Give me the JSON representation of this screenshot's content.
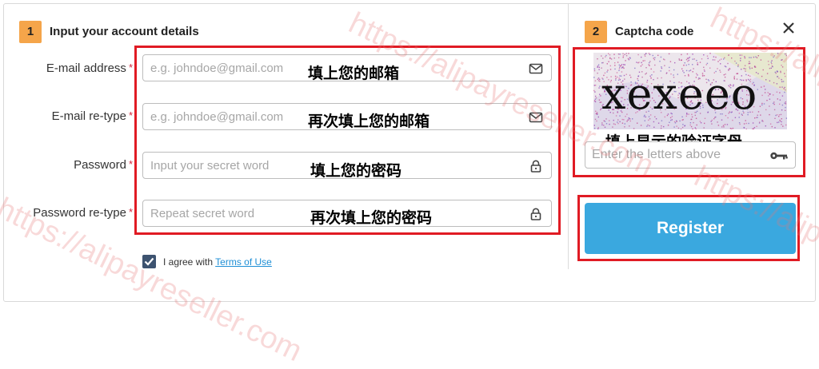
{
  "step1": {
    "number": "1",
    "title": "Input your account details"
  },
  "step2": {
    "number": "2",
    "title": "Captcha code"
  },
  "fields": [
    {
      "label": "E-mail address",
      "required": "*",
      "placeholder": "e.g. johndoe@gmail.com",
      "icon": "envelope-icon",
      "annotation": "填上您的邮箱"
    },
    {
      "label": "E-mail re-type",
      "required": "*",
      "placeholder": "e.g. johndoe@gmail.com",
      "icon": "envelope-icon",
      "annotation": "再次填上您的邮箱"
    },
    {
      "label": "Password",
      "required": "*",
      "placeholder": "Input your secret word",
      "icon": "lock-icon",
      "annotation": "填上您的密码"
    },
    {
      "label": "Password re-type",
      "required": "*",
      "placeholder": "Repeat secret word",
      "icon": "lock-icon",
      "annotation": "再次填上您的密码"
    }
  ],
  "agree": {
    "text": "I agree with",
    "link": "Terms of Use",
    "checked": true
  },
  "captcha": {
    "image_text": "xexeeo",
    "annotation": "填上显示的验证字母",
    "placeholder": "Enter the letters above",
    "icon": "key-icon"
  },
  "register": {
    "label": "Register"
  },
  "close": {
    "icon": "close-icon"
  },
  "watermark": {
    "text": "https://alipayreseller.com"
  },
  "colors": {
    "accent": "#3aa8df",
    "badge": "#f5a54a",
    "highlight": "#e01b24",
    "required": "#d0263b",
    "link": "#1f8fd6"
  }
}
